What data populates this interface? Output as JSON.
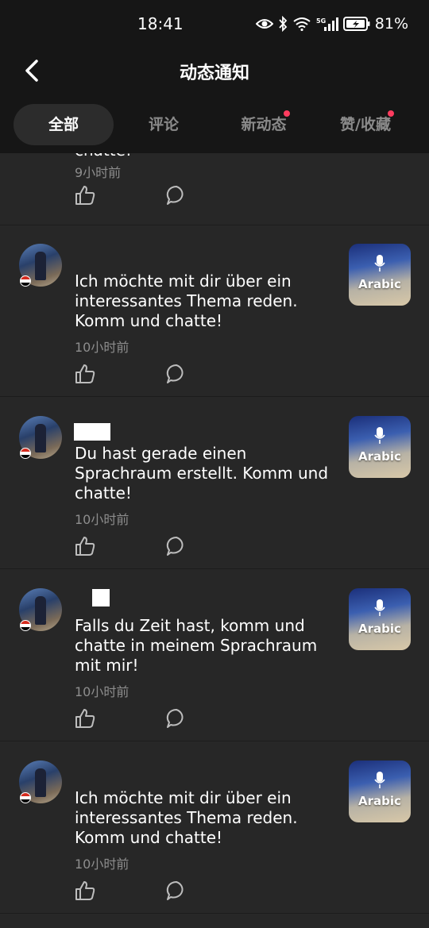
{
  "status": {
    "time": "18:41",
    "battery": "81%"
  },
  "header": {
    "title": "动态通知"
  },
  "tabs": [
    {
      "label": "全部",
      "active": true,
      "badge": false
    },
    {
      "label": "评论",
      "active": false,
      "badge": false
    },
    {
      "label": "新动态",
      "active": false,
      "badge": true
    },
    {
      "label": "赞/收藏",
      "active": false,
      "badge": true
    }
  ],
  "feed": [
    {
      "text": "chatte!",
      "time": "9小时前"
    },
    {
      "text": "Ich möchte mit dir über ein interessantes Thema reden. Komm und chatte!",
      "time": "10小时前",
      "thumb_label": "Arabic"
    },
    {
      "text": "Du hast gerade einen Sprachraum erstellt. Komm und chatte!",
      "time": "10小时前",
      "thumb_label": "Arabic"
    },
    {
      "text": "Falls du Zeit hast, komm und chatte in meinem Sprachraum mit mir!",
      "time": "10小时前",
      "thumb_label": "Arabic"
    },
    {
      "text": "Ich möchte mit dir über ein interessantes Thema reden. Komm und chatte!",
      "time": "10小时前",
      "thumb_label": "Arabic"
    }
  ],
  "colors": {
    "background": "#272727",
    "topbar": "#161616",
    "badge": "#ff3c5f",
    "muted_text": "#8d8d8d"
  }
}
